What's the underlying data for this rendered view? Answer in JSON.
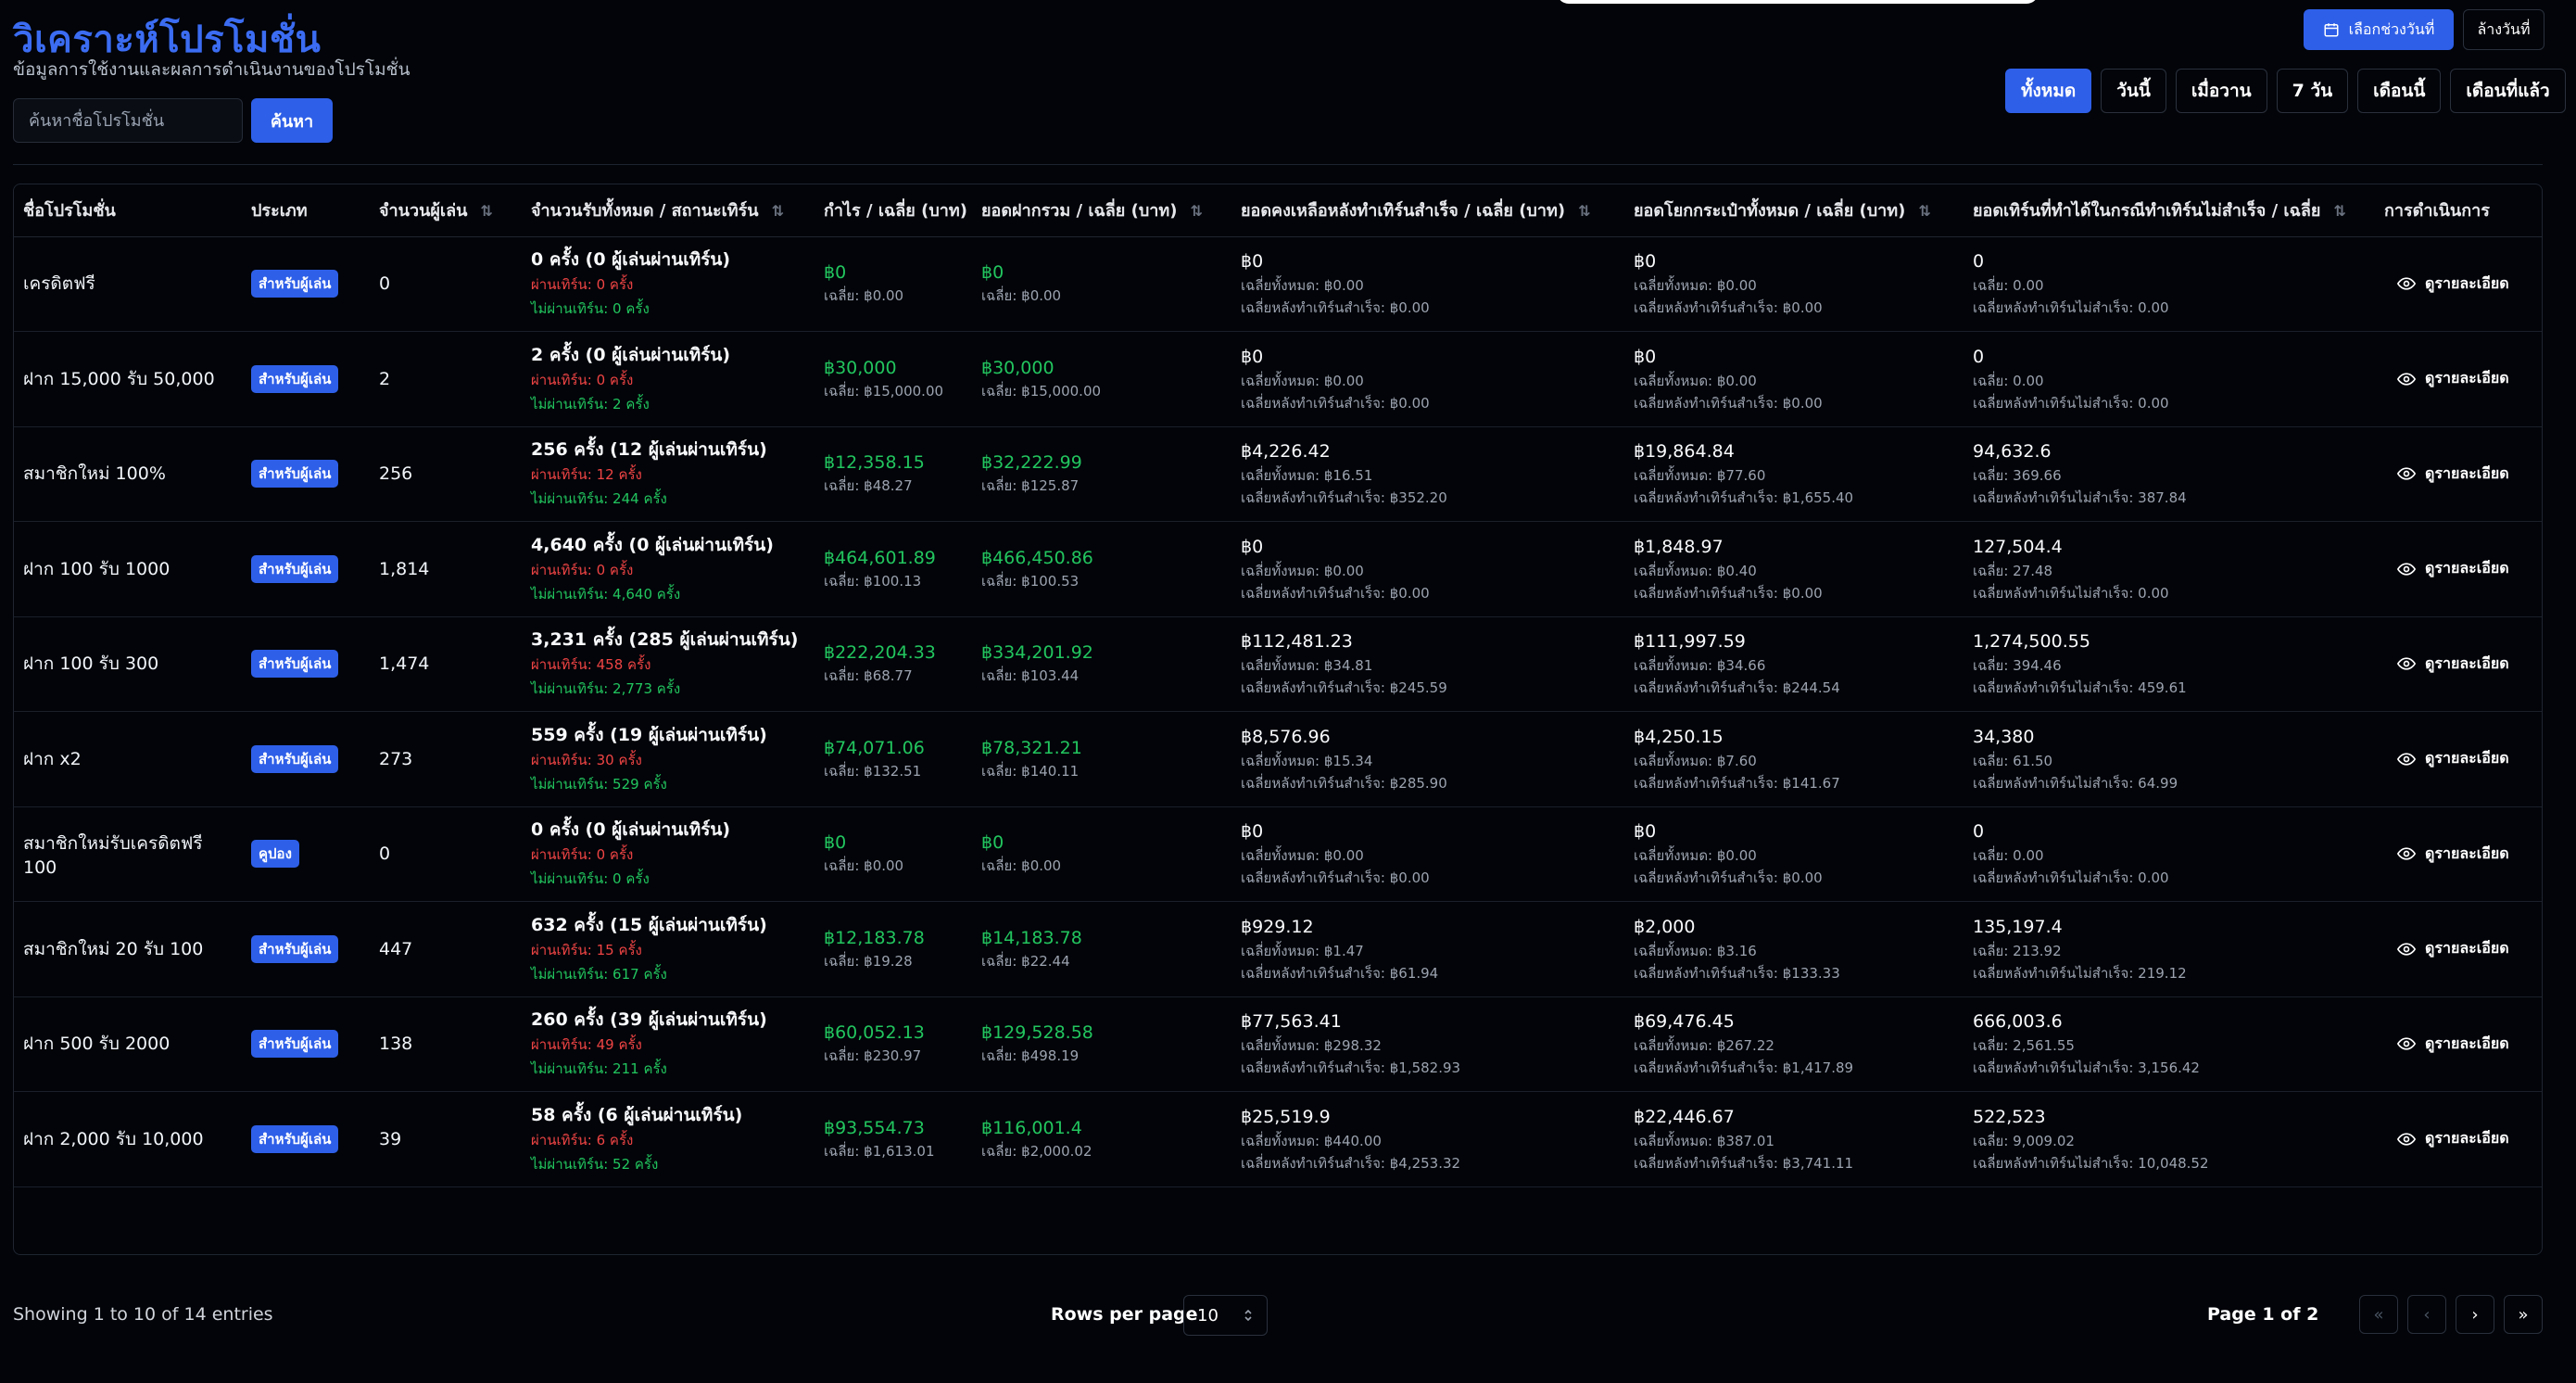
{
  "header": {
    "title": "วิเคราะห์โปรโมชั่น",
    "subtitle": "ข้อมูลการใช้งานและผลการดำเนินงานของโปรโมชั่น",
    "search_placeholder": "ค้นหาชื่อโปรโมชั่น",
    "search_button": "ค้นหา",
    "date_picker_label": "เลือกช่วงวันที่",
    "today_label": "ล้างวันที่",
    "range_tabs": [
      "ทั้งหมด",
      "วันนี้",
      "เมื่อวาน",
      "7 วัน",
      "เดือนนี้",
      "เดือนที่แล้ว"
    ],
    "active_range": "ทั้งหมด"
  },
  "table": {
    "columns": [
      "ชื่อโปรโมชั่น",
      "ประเภท",
      "จำนวนผู้เล่น",
      "จำนวนรับทั้งหมด / สถานะเทิร์น",
      "กำไร / เฉลี่ย (บาท)",
      "ยอดฝากรวม / เฉลี่ย (บาท)",
      "ยอดคงเหลือหลังทำเทิร์นสำเร็จ / เฉลี่ย (บาท)",
      "ยอดโยกกระเป๋าทั้งหมด / เฉลี่ย (บาท)",
      "ยอดเทิร์นที่ทำได้ในกรณีทำเทิร์นไม่สำเร็จ / เฉลี่ย",
      "การดำเนินการ"
    ],
    "action_label": "ดูรายละเอียด",
    "rows": [
      {
        "name": "เครดิตฟรี",
        "type": "สำหรับผู้เล่น",
        "players": "0",
        "claims": "0 ครั้ง (0 ผู้เล่นผ่านเทิร์น)",
        "passed": "ผ่านเทิร์น: 0 ครั้ง",
        "failed": "ไม่ผ่านเทิร์น: 0 ครั้ง",
        "profit": "฿0",
        "profit_avg": "เฉลี่ย: ฿0.00",
        "deposit": "฿0",
        "deposit_avg": "เฉลี่ย: ฿0.00",
        "remain": "฿0",
        "remain_avg": "เฉลี่ยทั้งหมด: ฿0.00",
        "remain_avg2": "เฉลี่ยหลังทำเทิร์นสำเร็จ: ฿0.00",
        "transfer": "฿0",
        "transfer_avg": "เฉลี่ยทั้งหมด: ฿0.00",
        "transfer_avg2": "เฉลี่ยหลังทำเทิร์นสำเร็จ: ฿0.00",
        "turn": "0",
        "turn_avg": "เฉลี่ย: 0.00",
        "turn_avg2": "เฉลี่ยหลังทำเทิร์นไม่สำเร็จ: 0.00"
      },
      {
        "name": "ฝาก 15,000 รับ 50,000",
        "type": "สำหรับผู้เล่น",
        "players": "2",
        "claims": "2 ครั้ง (0 ผู้เล่นผ่านเทิร์น)",
        "passed": "ผ่านเทิร์น: 0 ครั้ง",
        "failed": "ไม่ผ่านเทิร์น: 2 ครั้ง",
        "profit": "฿30,000",
        "profit_avg": "เฉลี่ย: ฿15,000.00",
        "deposit": "฿30,000",
        "deposit_avg": "เฉลี่ย: ฿15,000.00",
        "remain": "฿0",
        "remain_avg": "เฉลี่ยทั้งหมด: ฿0.00",
        "remain_avg2": "เฉลี่ยหลังทำเทิร์นสำเร็จ: ฿0.00",
        "transfer": "฿0",
        "transfer_avg": "เฉลี่ยทั้งหมด: ฿0.00",
        "transfer_avg2": "เฉลี่ยหลังทำเทิร์นสำเร็จ: ฿0.00",
        "turn": "0",
        "turn_avg": "เฉลี่ย: 0.00",
        "turn_avg2": "เฉลี่ยหลังทำเทิร์นไม่สำเร็จ: 0.00"
      },
      {
        "name": "สมาชิกใหม่ 100%",
        "type": "สำหรับผู้เล่น",
        "players": "256",
        "claims": "256 ครั้ง (12 ผู้เล่นผ่านเทิร์น)",
        "passed": "ผ่านเทิร์น: 12 ครั้ง",
        "failed": "ไม่ผ่านเทิร์น: 244 ครั้ง",
        "profit": "฿12,358.15",
        "profit_avg": "เฉลี่ย: ฿48.27",
        "deposit": "฿32,222.99",
        "deposit_avg": "เฉลี่ย: ฿125.87",
        "remain": "฿4,226.42",
        "remain_avg": "เฉลี่ยทั้งหมด: ฿16.51",
        "remain_avg2": "เฉลี่ยหลังทำเทิร์นสำเร็จ: ฿352.20",
        "transfer": "฿19,864.84",
        "transfer_avg": "เฉลี่ยทั้งหมด: ฿77.60",
        "transfer_avg2": "เฉลี่ยหลังทำเทิร์นสำเร็จ: ฿1,655.40",
        "turn": "94,632.6",
        "turn_avg": "เฉลี่ย: 369.66",
        "turn_avg2": "เฉลี่ยหลังทำเทิร์นไม่สำเร็จ: 387.84"
      },
      {
        "name": "ฝาก 100 รับ 1000",
        "type": "สำหรับผู้เล่น",
        "players": "1,814",
        "claims": "4,640 ครั้ง (0 ผู้เล่นผ่านเทิร์น)",
        "passed": "ผ่านเทิร์น: 0 ครั้ง",
        "failed": "ไม่ผ่านเทิร์น: 4,640 ครั้ง",
        "profit": "฿464,601.89",
        "profit_avg": "เฉลี่ย: ฿100.13",
        "deposit": "฿466,450.86",
        "deposit_avg": "เฉลี่ย: ฿100.53",
        "remain": "฿0",
        "remain_avg": "เฉลี่ยทั้งหมด: ฿0.00",
        "remain_avg2": "เฉลี่ยหลังทำเทิร์นสำเร็จ: ฿0.00",
        "transfer": "฿1,848.97",
        "transfer_avg": "เฉลี่ยทั้งหมด: ฿0.40",
        "transfer_avg2": "เฉลี่ยหลังทำเทิร์นสำเร็จ: ฿0.00",
        "turn": "127,504.4",
        "turn_avg": "เฉลี่ย: 27.48",
        "turn_avg2": "เฉลี่ยหลังทำเทิร์นไม่สำเร็จ: 0.00"
      },
      {
        "name": "ฝาก 100 รับ 300",
        "type": "สำหรับผู้เล่น",
        "players": "1,474",
        "claims": "3,231 ครั้ง (285 ผู้เล่นผ่านเทิร์น)",
        "passed": "ผ่านเทิร์น: 458 ครั้ง",
        "failed": "ไม่ผ่านเทิร์น: 2,773 ครั้ง",
        "profit": "฿222,204.33",
        "profit_avg": "เฉลี่ย: ฿68.77",
        "deposit": "฿334,201.92",
        "deposit_avg": "เฉลี่ย: ฿103.44",
        "remain": "฿112,481.23",
        "remain_avg": "เฉลี่ยทั้งหมด: ฿34.81",
        "remain_avg2": "เฉลี่ยหลังทำเทิร์นสำเร็จ: ฿245.59",
        "transfer": "฿111,997.59",
        "transfer_avg": "เฉลี่ยทั้งหมด: ฿34.66",
        "transfer_avg2": "เฉลี่ยหลังทำเทิร์นสำเร็จ: ฿244.54",
        "turn": "1,274,500.55",
        "turn_avg": "เฉลี่ย: 394.46",
        "turn_avg2": "เฉลี่ยหลังทำเทิร์นไม่สำเร็จ: 459.61"
      },
      {
        "name": "ฝาก x2",
        "type": "สำหรับผู้เล่น",
        "players": "273",
        "claims": "559 ครั้ง (19 ผู้เล่นผ่านเทิร์น)",
        "passed": "ผ่านเทิร์น: 30 ครั้ง",
        "failed": "ไม่ผ่านเทิร์น: 529 ครั้ง",
        "profit": "฿74,071.06",
        "profit_avg": "เฉลี่ย: ฿132.51",
        "deposit": "฿78,321.21",
        "deposit_avg": "เฉลี่ย: ฿140.11",
        "remain": "฿8,576.96",
        "remain_avg": "เฉลี่ยทั้งหมด: ฿15.34",
        "remain_avg2": "เฉลี่ยหลังทำเทิร์นสำเร็จ: ฿285.90",
        "transfer": "฿4,250.15",
        "transfer_avg": "เฉลี่ยทั้งหมด: ฿7.60",
        "transfer_avg2": "เฉลี่ยหลังทำเทิร์นสำเร็จ: ฿141.67",
        "turn": "34,380",
        "turn_avg": "เฉลี่ย: 61.50",
        "turn_avg2": "เฉลี่ยหลังทำเทิร์นไม่สำเร็จ: 64.99"
      },
      {
        "name": "สมาชิกใหม่รับเครดิตฟรี 100",
        "type": "คูปอง",
        "players": "0",
        "claims": "0 ครั้ง (0 ผู้เล่นผ่านเทิร์น)",
        "passed": "ผ่านเทิร์น: 0 ครั้ง",
        "failed": "ไม่ผ่านเทิร์น: 0 ครั้ง",
        "profit": "฿0",
        "profit_avg": "เฉลี่ย: ฿0.00",
        "deposit": "฿0",
        "deposit_avg": "เฉลี่ย: ฿0.00",
        "remain": "฿0",
        "remain_avg": "เฉลี่ยทั้งหมด: ฿0.00",
        "remain_avg2": "เฉลี่ยหลังทำเทิร์นสำเร็จ: ฿0.00",
        "transfer": "฿0",
        "transfer_avg": "เฉลี่ยทั้งหมด: ฿0.00",
        "transfer_avg2": "เฉลี่ยหลังทำเทิร์นสำเร็จ: ฿0.00",
        "turn": "0",
        "turn_avg": "เฉลี่ย: 0.00",
        "turn_avg2": "เฉลี่ยหลังทำเทิร์นไม่สำเร็จ: 0.00"
      },
      {
        "name": "สมาชิกใหม่ 20 รับ 100",
        "type": "สำหรับผู้เล่น",
        "players": "447",
        "claims": "632 ครั้ง (15 ผู้เล่นผ่านเทิร์น)",
        "passed": "ผ่านเทิร์น: 15 ครั้ง",
        "failed": "ไม่ผ่านเทิร์น: 617 ครั้ง",
        "profit": "฿12,183.78",
        "profit_avg": "เฉลี่ย: ฿19.28",
        "deposit": "฿14,183.78",
        "deposit_avg": "เฉลี่ย: ฿22.44",
        "remain": "฿929.12",
        "remain_avg": "เฉลี่ยทั้งหมด: ฿1.47",
        "remain_avg2": "เฉลี่ยหลังทำเทิร์นสำเร็จ: ฿61.94",
        "transfer": "฿2,000",
        "transfer_avg": "เฉลี่ยทั้งหมด: ฿3.16",
        "transfer_avg2": "เฉลี่ยหลังทำเทิร์นสำเร็จ: ฿133.33",
        "turn": "135,197.4",
        "turn_avg": "เฉลี่ย: 213.92",
        "turn_avg2": "เฉลี่ยหลังทำเทิร์นไม่สำเร็จ: 219.12"
      },
      {
        "name": "ฝาก 500 รับ 2000",
        "type": "สำหรับผู้เล่น",
        "players": "138",
        "claims": "260 ครั้ง (39 ผู้เล่นผ่านเทิร์น)",
        "passed": "ผ่านเทิร์น: 49 ครั้ง",
        "failed": "ไม่ผ่านเทิร์น: 211 ครั้ง",
        "profit": "฿60,052.13",
        "profit_avg": "เฉลี่ย: ฿230.97",
        "deposit": "฿129,528.58",
        "deposit_avg": "เฉลี่ย: ฿498.19",
        "remain": "฿77,563.41",
        "remain_avg": "เฉลี่ยทั้งหมด: ฿298.32",
        "remain_avg2": "เฉลี่ยหลังทำเทิร์นสำเร็จ: ฿1,582.93",
        "transfer": "฿69,476.45",
        "transfer_avg": "เฉลี่ยทั้งหมด: ฿267.22",
        "transfer_avg2": "เฉลี่ยหลังทำเทิร์นสำเร็จ: ฿1,417.89",
        "turn": "666,003.6",
        "turn_avg": "เฉลี่ย: 2,561.55",
        "turn_avg2": "เฉลี่ยหลังทำเทิร์นไม่สำเร็จ: 3,156.42"
      },
      {
        "name": "ฝาก 2,000 รับ 10,000",
        "type": "สำหรับผู้เล่น",
        "players": "39",
        "claims": "58 ครั้ง (6 ผู้เล่นผ่านเทิร์น)",
        "passed": "ผ่านเทิร์น: 6 ครั้ง",
        "failed": "ไม่ผ่านเทิร์น: 52 ครั้ง",
        "profit": "฿93,554.73",
        "profit_avg": "เฉลี่ย: ฿1,613.01",
        "deposit": "฿116,001.4",
        "deposit_avg": "เฉลี่ย: ฿2,000.02",
        "remain": "฿25,519.9",
        "remain_avg": "เฉลี่ยทั้งหมด: ฿440.00",
        "remain_avg2": "เฉลี่ยหลังทำเทิร์นสำเร็จ: ฿4,253.32",
        "transfer": "฿22,446.67",
        "transfer_avg": "เฉลี่ยทั้งหมด: ฿387.01",
        "transfer_avg2": "เฉลี่ยหลังทำเทิร์นสำเร็จ: ฿3,741.11",
        "turn": "522,523",
        "turn_avg": "เฉลี่ย: 9,009.02",
        "turn_avg2": "เฉลี่ยหลังทำเทิร์นไม่สำเร็จ: 10,048.52"
      }
    ]
  },
  "footer": {
    "entries_text": "Showing 1 to 10 of 14 entries",
    "rows_per_page_label": "Rows per page",
    "rows_per_page_value": "10",
    "page_text": "Page 1 of 2"
  },
  "icons": {
    "calendar": "calendar-icon",
    "view": "eye-icon",
    "sort": "sort-arrows-icon",
    "pager": [
      "chevrons-left-icon",
      "chevron-left-icon",
      "chevron-right-icon",
      "chevrons-right-icon"
    ]
  },
  "colors": {
    "accent": "#2e5fe8",
    "title": "#3b6cf2",
    "positive": "#22c55e",
    "negative": "#ef4444",
    "background": "#020409"
  }
}
